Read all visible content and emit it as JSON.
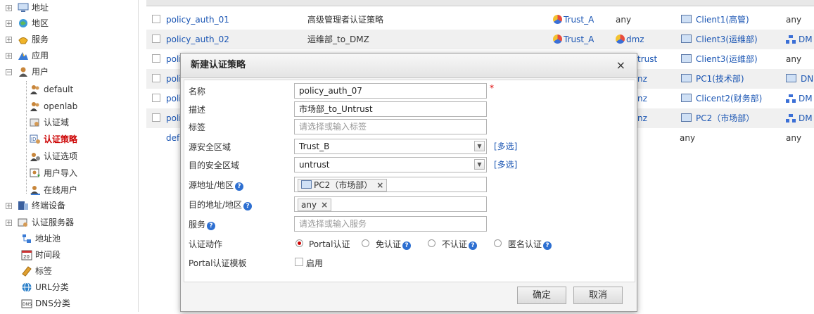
{
  "sidebar": {
    "items": [
      {
        "label": "地址",
        "icon": "address-icon",
        "expander": "+"
      },
      {
        "label": "地区",
        "icon": "region-icon",
        "expander": "+"
      },
      {
        "label": "服务",
        "icon": "service-icon",
        "expander": "+"
      },
      {
        "label": "应用",
        "icon": "application-icon",
        "expander": "+"
      },
      {
        "label": "用户",
        "icon": "user-icon",
        "expander": "−"
      },
      {
        "label": "default",
        "icon": "user-group-icon"
      },
      {
        "label": "openlab",
        "icon": "user-group-icon"
      },
      {
        "label": "认证域",
        "icon": "auth-domain-icon"
      },
      {
        "label": "认证策略",
        "icon": "auth-policy-icon",
        "active": true
      },
      {
        "label": "认证选项",
        "icon": "auth-option-icon"
      },
      {
        "label": "用户导入",
        "icon": "user-import-icon"
      },
      {
        "label": "在线用户",
        "icon": "online-user-icon"
      },
      {
        "label": "终端设备",
        "icon": "terminal-device-icon",
        "expander": "+"
      },
      {
        "label": "认证服务器",
        "icon": "auth-server-icon",
        "expander": "+"
      },
      {
        "label": "地址池",
        "icon": "address-pool-icon"
      },
      {
        "label": "时间段",
        "icon": "time-range-icon"
      },
      {
        "label": "标签",
        "icon": "tag-icon"
      },
      {
        "label": "URL分类",
        "icon": "url-category-icon"
      },
      {
        "label": "DNS分类",
        "icon": "dns-category-icon"
      }
    ]
  },
  "table": {
    "rows": [
      {
        "name": "policy_auth_01",
        "desc": "高级管理者认证策略",
        "src_zone": "Trust_A",
        "dst_zone": "any",
        "src_addr": "Client1(高管)",
        "dst": "any"
      },
      {
        "name": "policy_auth_02",
        "desc": "运维部_to_DMZ",
        "src_zone": "Trust_A",
        "dst_zone": "dmz",
        "src_addr": "Client3(运维部)",
        "dst": "DM"
      },
      {
        "name": "poli",
        "desc": "",
        "src_zone": "",
        "dst_zone": "trust",
        "src_addr": "Client3(运维部)",
        "dst": "any"
      },
      {
        "name": "poli",
        "desc": "",
        "src_zone": "",
        "dst_zone": "nz",
        "src_addr": "PC1(技术部)",
        "dst": "DN"
      },
      {
        "name": "poli",
        "desc": "",
        "src_zone": "",
        "dst_zone": "nz",
        "src_addr": "Clicent2(财务部)",
        "dst": "DM"
      },
      {
        "name": "poli",
        "desc": "",
        "src_zone": "",
        "dst_zone": "nz",
        "src_addr": "PC2（市场部）",
        "dst": "DM"
      },
      {
        "name": "defa",
        "desc": "",
        "src_zone": "",
        "dst_zone": "",
        "src_addr": "any",
        "dst": "any"
      }
    ]
  },
  "dialog": {
    "title": "新建认证策略",
    "close": "×",
    "fields": {
      "name": {
        "label": "名称",
        "value": "policy_auth_07",
        "required": "*"
      },
      "desc": {
        "label": "描述",
        "value": "市场部_to_Untrust"
      },
      "tag": {
        "label": "标签",
        "placeholder": "请选择或输入标签"
      },
      "src_zone": {
        "label": "源安全区域",
        "value": "Trust_B",
        "multi": "[多选]"
      },
      "dst_zone": {
        "label": "目的安全区域",
        "value": "untrust",
        "multi": "[多选]"
      },
      "src_addr": {
        "label": "源地址/地区",
        "tag": "PC2（市场部）"
      },
      "dst_addr": {
        "label": "目的地址/地区",
        "tag": "any"
      },
      "service": {
        "label": "服务",
        "placeholder": "请选择或输入服务"
      },
      "action": {
        "label": "认证动作",
        "options": [
          "Portal认证",
          "免认证",
          "不认证",
          "匿名认证"
        ],
        "selected": "Portal认证"
      },
      "template": {
        "label": "Portal认证模板",
        "checkbox_label": "启用"
      }
    },
    "ok": "确定",
    "cancel": "取消"
  },
  "colors": {
    "link": "#1a55b3",
    "active": "#cc0000",
    "required": "#dd0000"
  }
}
